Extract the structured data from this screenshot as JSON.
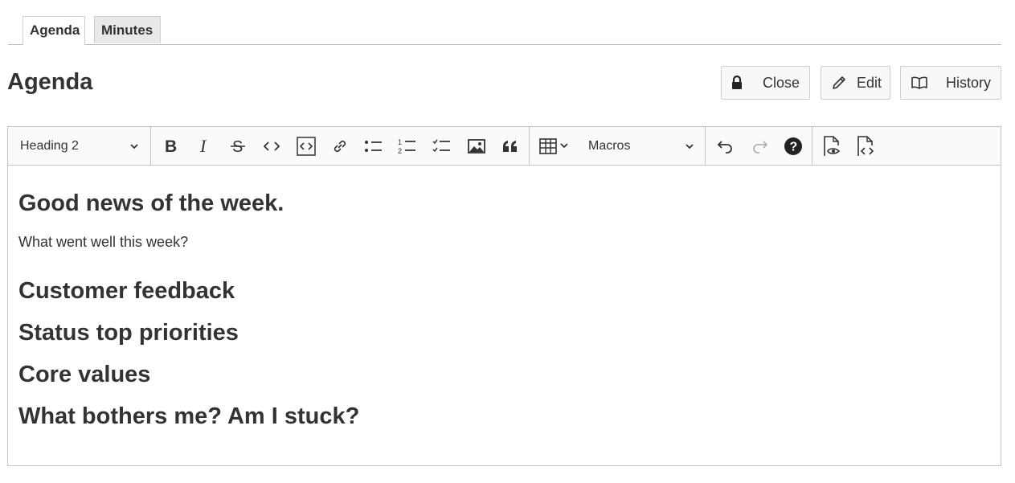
{
  "tabs": [
    {
      "label": "Agenda",
      "active": true
    },
    {
      "label": "Minutes",
      "active": false
    }
  ],
  "page_title": "Agenda",
  "actions": {
    "close_label": "Close",
    "edit_label": "Edit",
    "history_label": "History"
  },
  "toolbar": {
    "heading_select": "Heading 2",
    "macros_select": "Macros",
    "buttons": [
      "bold-icon",
      "italic-icon",
      "strikethrough-icon",
      "code-icon",
      "code-block-icon",
      "link-icon",
      "bulleted-list-icon",
      "numbered-list-icon",
      "todo-list-icon",
      "image-icon",
      "blockquote-icon",
      "table-icon",
      "undo-icon",
      "redo-icon",
      "help-icon",
      "preview-icon",
      "source-icon"
    ]
  },
  "content": {
    "h1": "Good news of the week.",
    "p1": "What went well this week?",
    "h2": "Customer feedback",
    "h3": "Status top priorities",
    "h4": "Core values",
    "h5": "What bothers me? Am I stuck?"
  }
}
